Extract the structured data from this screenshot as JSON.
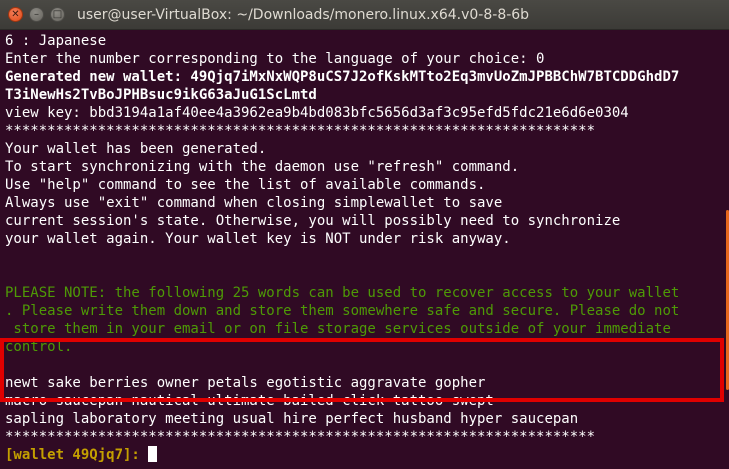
{
  "window": {
    "title": "user@user-VirtualBox: ~/Downloads/monero.linux.x64.v0-8-8-6b",
    "close_glyph": "✕",
    "minimize_glyph": "–",
    "maximize_glyph": "□"
  },
  "terminal": {
    "lines": [
      "6 : Japanese",
      "Enter the number corresponding to the language of your choice: 0",
      "Generated new wallet: 49Qjq7iMxNxWQP8uCS7J2ofKskMTto2Eq3mvUoZmJPBBChW7BTCDDGhdD7",
      "T3iNewHs2TvBoJPHBsuc9ikG63aJuG1ScLmtd",
      "view key: bbd3194a1af40ee4a3962ea9b4bd083bfc5656d3af3c95efd5fdc21e6d6e0304",
      "**********************************************************************",
      "Your wallet has been generated.",
      "To start synchronizing with the daemon use \"refresh\" command.",
      "Use \"help\" command to see the list of available commands.",
      "Always use \"exit\" command when closing simplewallet to save",
      "current session's state. Otherwise, you will possibly need to synchronize",
      "your wallet again. Your wallet key is NOT under risk anyway.",
      "",
      "",
      "PLEASE NOTE: the following 25 words can be used to recover access to your wallet",
      ". Please write them down and store them somewhere safe and secure. Please do not",
      " store them in your email or on file storage services outside of your immediate",
      "control.",
      "",
      "newt sake berries owner petals egotistic aggravate gopher",
      "macro saucepan nautical ultimate bailed click tattoo swept",
      "sapling laboratory meeting usual hire perfect husband hyper saucepan",
      "**********************************************************************",
      ""
    ],
    "prompt": "[wallet 49Qjq7]: "
  },
  "colors": {
    "background": "#300a24",
    "foreground": "#ffffff",
    "note_green": "#4e9a06",
    "prompt_yellow": "#c4a000",
    "highlight_red": "#e00000",
    "scroll_orange": "#e6681c"
  }
}
